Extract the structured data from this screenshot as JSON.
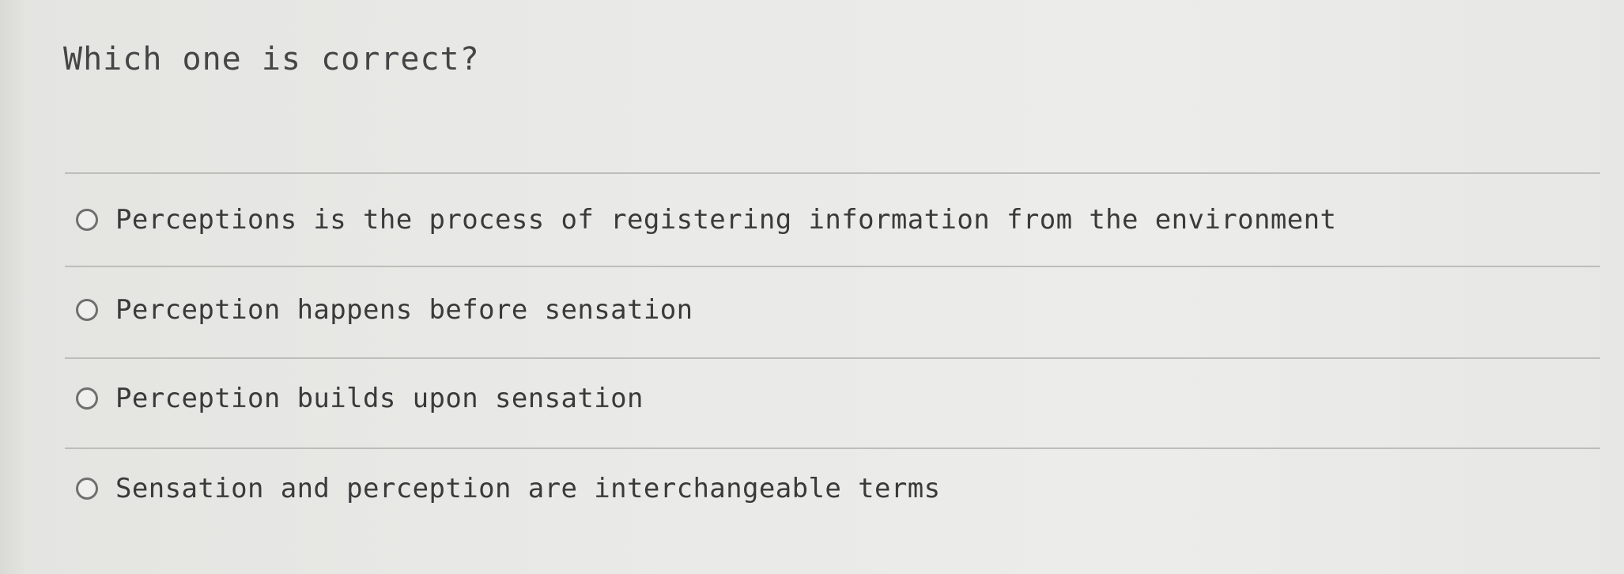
{
  "question": {
    "text": "Which one is correct?"
  },
  "options": [
    {
      "label": "Perceptions is the process of registering information from the environment",
      "selected": false
    },
    {
      "label": "Perception happens before sensation",
      "selected": false
    },
    {
      "label": "Perception builds upon sensation",
      "selected": false
    },
    {
      "label": "Sensation and perception are interchangeable terms",
      "selected": false
    }
  ],
  "colors": {
    "background": "#e9e9e7",
    "text": "#3f3f3f",
    "divider": "#bdbdba",
    "radio_border": "#6f6f6d"
  }
}
